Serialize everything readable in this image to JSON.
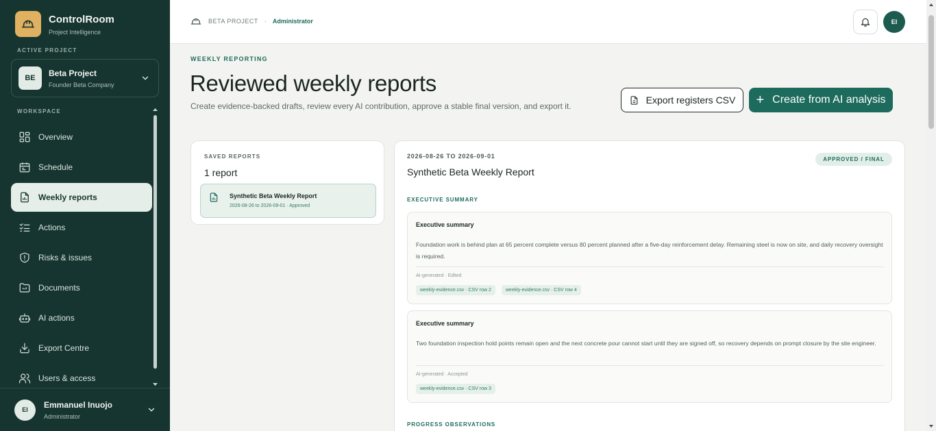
{
  "app": {
    "name": "ControlRoom",
    "tagline": "Project Intelligence"
  },
  "sidebar": {
    "active_project_label": "ACTIVE PROJECT",
    "project": {
      "badge": "BE",
      "name": "Beta Project",
      "company": "Founder Beta Company"
    },
    "workspace_label": "WORKSPACE",
    "items": [
      {
        "label": "Overview",
        "icon": "grid-icon"
      },
      {
        "label": "Schedule",
        "icon": "calendar-icon"
      },
      {
        "label": "Weekly reports",
        "icon": "report-icon",
        "active": true
      },
      {
        "label": "Actions",
        "icon": "checklist-icon"
      },
      {
        "label": "Risks & issues",
        "icon": "shield-alert-icon"
      },
      {
        "label": "Documents",
        "icon": "folder-icon"
      },
      {
        "label": "AI actions",
        "icon": "robot-icon"
      },
      {
        "label": "Export Centre",
        "icon": "download-icon"
      },
      {
        "label": "Users & access",
        "icon": "users-icon"
      }
    ],
    "user": {
      "initials": "EI",
      "name": "Emmanuel Inuojo",
      "role": "Administrator"
    }
  },
  "header": {
    "breadcrumb": {
      "project": "BETA PROJECT",
      "separator": "·",
      "role": "Administrator"
    },
    "avatar_initials": "EI"
  },
  "main": {
    "kicker": "WEEKLY REPORTING",
    "title": "Reviewed weekly reports",
    "description": "Create evidence-backed drafts, review every AI contribution, approve a stable final version, and export it.",
    "export_button": "Export registers CSV",
    "create_button": "Create from AI analysis",
    "create_button_icon": "+"
  },
  "saved_reports": {
    "label": "SAVED REPORTS",
    "count": "1 report",
    "items": [
      {
        "title": "Synthetic Beta Weekly Report",
        "meta": "2026-08-26 to 2026-09-01 · Approved"
      }
    ]
  },
  "report": {
    "date_range": "2026-08-26 TO 2026-09-01",
    "title": "Synthetic Beta Weekly Report",
    "status": "APPROVED / FINAL",
    "sections": [
      {
        "heading": "EXECUTIVE SUMMARY",
        "entries": [
          {
            "title": "Executive summary",
            "body": "Foundation work is behind plan at 65 percent complete versus 80 percent planned after a five-day reinforcement delay. Remaining steel is now on site, and daily recovery oversight is required.",
            "meta": "AI-generated · Edited",
            "chips": [
              "weekly-evidence.csv · CSV row 2",
              "weekly-evidence.csv · CSV row 4"
            ]
          },
          {
            "title": "Executive summary",
            "body": "Two foundation inspection hold points remain open and the next concrete pour cannot start until they are signed off, so recovery depends on prompt closure by the site engineer.",
            "meta": "AI-generated · Accepted",
            "chips": [
              "weekly-evidence.csv · CSV row 3"
            ]
          }
        ]
      },
      {
        "heading": "PROGRESS OBSERVATIONS",
        "entries": []
      }
    ]
  },
  "colors": {
    "sidebar": "#163530",
    "accent": "#1d6b5d",
    "logo": "#e0b160"
  }
}
